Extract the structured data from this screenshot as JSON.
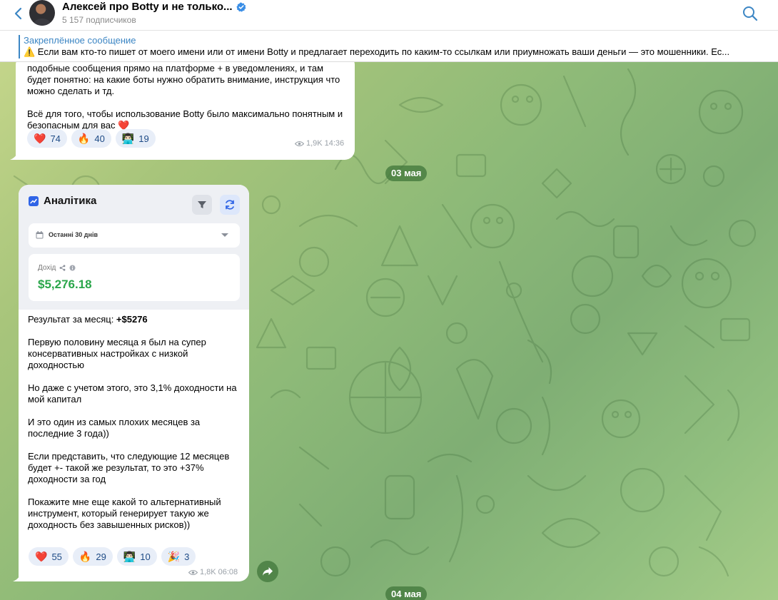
{
  "header": {
    "title": "Алексей про Botty и не только...",
    "subscribers": "5 157 подписчиков"
  },
  "pinned": {
    "label": "Закреплённое сообщение",
    "text": "⚠️ Если вам кто-то пишет от моего имени или от имени Botty и предлагает переходить по каким-то ссылкам или приумножать ваши деньги — это мошенники.   Ес..."
  },
  "messages": [
    {
      "paragraphs": [
        "подобные сообщения прямо на платформе + в уведомлениях, и там будет понятно: на какие боты нужно обратить внимание, инструкция что можно сделать и тд.",
        "Всё для того, чтобы использование Botty было максимально понятным и безопасным для вас ❤️"
      ],
      "reactions": [
        {
          "emoji": "❤️",
          "count": "74"
        },
        {
          "emoji": "🔥",
          "count": "40"
        },
        {
          "emoji": "👨🏻‍💻",
          "count": "19"
        }
      ],
      "views": "1,9K",
      "time": "14:36"
    },
    {
      "card": {
        "title": "Аналітика",
        "period": "Останні 30 днів",
        "income_label": "Дохід",
        "income_value": "$5,276.18"
      },
      "result_prefix": "Результат за месяц: ",
      "result_value": "+$5276",
      "paragraphs": [
        "Первую половину месяца я был на супер консервативных настройках с низкой доходностью",
        "Но даже с учетом этого, это 3,1% доходности на мой капитал",
        "И это один из самых плохих месяцев за последние 3 года))",
        "Если представить, что следующие 12 месяцев будет +- такой же результат, то это +37% доходности за год",
        "Покажите мне еще какой то альтернативный инструмент, который генерирует такую же доходность без завышенных рисков))"
      ],
      "reactions": [
        {
          "emoji": "❤️",
          "count": "55"
        },
        {
          "emoji": "🔥",
          "count": "29"
        },
        {
          "emoji": "👨🏻‍💻",
          "count": "10"
        },
        {
          "emoji": "🎉",
          "count": "3"
        }
      ],
      "views": "1,8K",
      "time": "06:08"
    }
  ],
  "dates": [
    "03 мая",
    "04 мая"
  ],
  "colors": {
    "accent": "#3c86c4",
    "income_green": "#2aa64a",
    "verified": "#3a8ee6",
    "date_pill": "#4a7c40"
  },
  "icons": [
    "back-chevron-icon",
    "verified-icon",
    "search-icon",
    "filter-icon",
    "refresh-icon",
    "calendar-icon",
    "share-icon",
    "info-icon",
    "eye-icon",
    "forward-icon"
  ]
}
